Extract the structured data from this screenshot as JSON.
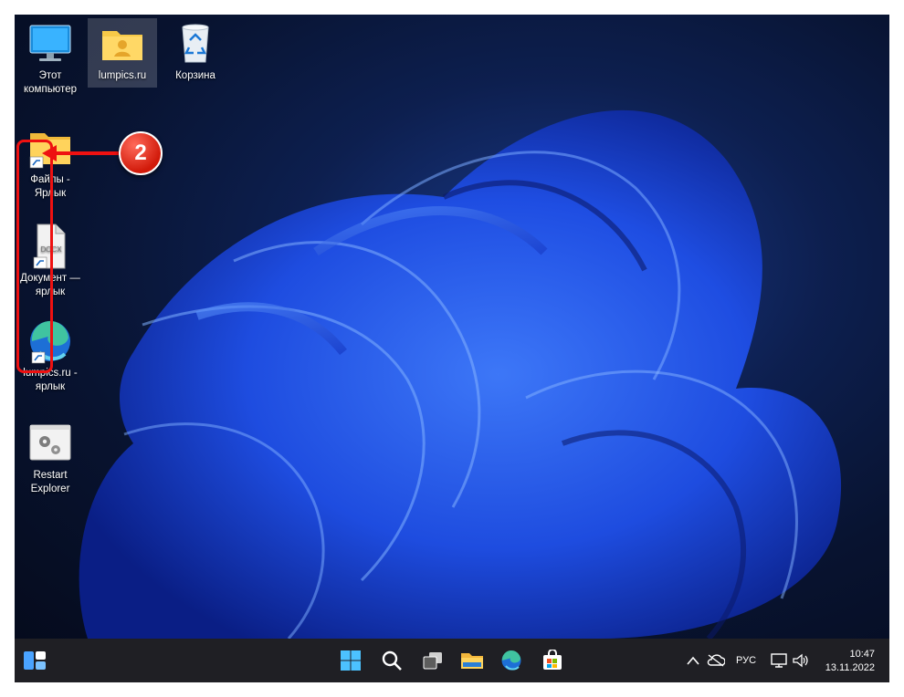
{
  "desktop_icons": [
    {
      "name": "this-pc-icon",
      "label": "Этот компьютер"
    },
    {
      "name": "user-folder-icon",
      "label": "lumpics.ru"
    },
    {
      "name": "recycle-bin-icon",
      "label": "Корзина"
    },
    {
      "name": "files-shortcut-icon",
      "label": "Файлы - Ярлык"
    },
    {
      "name": "document-shortcut-icon",
      "label": "Документ — ярлык"
    },
    {
      "name": "edge-shortcut-icon",
      "label": "lumpics.ru - ярлык"
    },
    {
      "name": "restart-explorer-icon",
      "label": "Restart Explorer"
    }
  ],
  "docx_label": "DOCX",
  "annotation": {
    "step": "2",
    "color": "#ee1111"
  },
  "taskbar": {
    "language": "РУС",
    "time": "10:47",
    "date": "13.11.2022"
  }
}
